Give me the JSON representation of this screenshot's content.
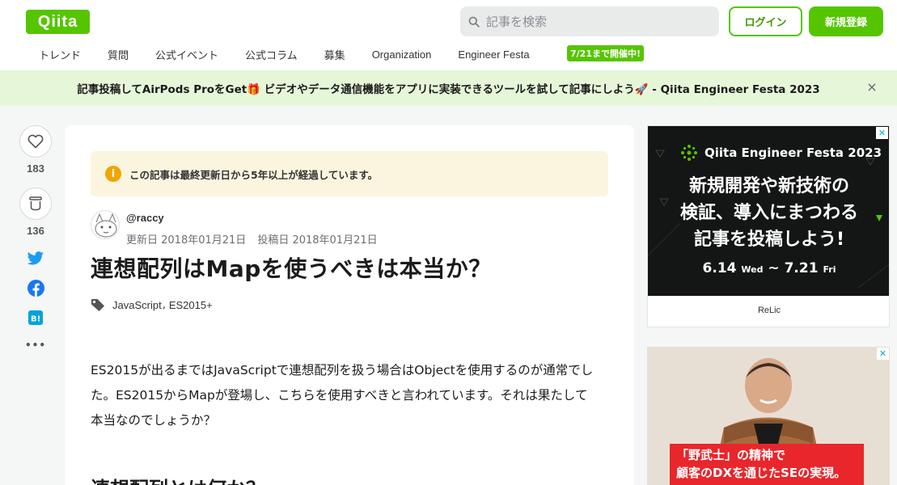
{
  "header": {
    "logo": "Qiita",
    "search_placeholder": "記事を検索",
    "login_label": "ログイン",
    "signup_label": "新規登録",
    "nav": [
      "トレンド",
      "質問",
      "公式イベント",
      "公式コラム",
      "募集",
      "Organization",
      "Engineer Festa"
    ],
    "nav_badge": "7/21まで開催中!",
    "brand_color": "#55c500"
  },
  "banner": {
    "text": "記事投稿してAirPods ProをGet🎁 ビデオやデータ通信機能をアプリに実装できるツールを試して記事にしよう🚀 - Qiita Engineer Festa 2023",
    "close_icon": "×"
  },
  "actions": {
    "like_count": "183",
    "stock_count": "136",
    "more_icon": "•••"
  },
  "article": {
    "notice": "この記事は最終更新日から5年以上が経過しています。",
    "notice_icon": "i",
    "author": "@raccy",
    "updated": "更新日 2018年01月21日",
    "posted": "投稿日 2018年01月21日",
    "title": "連想配列はMapを使うべきは本当か？",
    "tags": [
      "JavaScript",
      "ES2015+"
    ],
    "body_lines": [
      "ES2015が出るまではJavaScriptで連想配列を扱う場合はObjectを使用するのが通常でし",
      "た。ES2015からMapが登場し、こちらを使用すべきと言われています。それは果たして",
      "本当なのでしょうか？"
    ],
    "heading": "連想配列とは何か？"
  },
  "ads": {
    "ad1": {
      "brand": "Qiita Engineer Festa 2023",
      "headline_lines": [
        "新規開発や新技術の",
        "検証、導入にまつわる",
        "記事を投稿しよう!"
      ],
      "date_start": "6.14",
      "date_start_day": "Wed",
      "date_sep": "~",
      "date_end": "7.21",
      "date_end_day": "Fri",
      "sponsor": "ReLic"
    },
    "ad2": {
      "caption_line1": "「野武士」の精神で",
      "caption_line2": "顧客のDXを通じたSEの実現。"
    },
    "close_icon": "✕"
  }
}
